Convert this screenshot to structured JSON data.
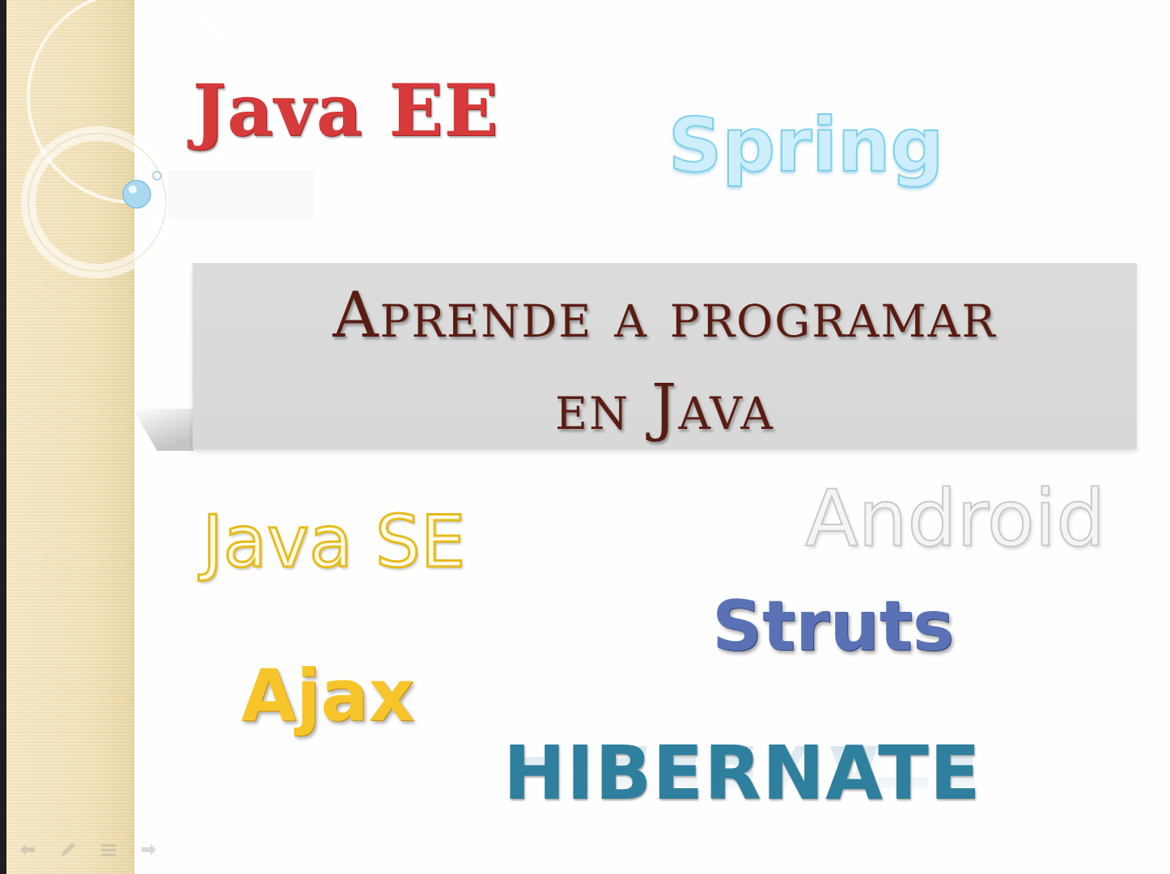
{
  "slide": {
    "title_line1": "Aprende a programar",
    "title_line2": "en Java",
    "words": {
      "java_ee": "Java EE",
      "spring": "Spring",
      "java_se": "Java SE",
      "android": "Android",
      "struts": "Struts",
      "ajax": "Ajax",
      "hibernate": "HIBERNATE"
    }
  },
  "nav": {
    "icons": [
      "back-arrow-icon",
      "pen-icon",
      "menu-icon",
      "forward-arrow-icon"
    ]
  },
  "colors": {
    "side_band": "#f2e1b6",
    "title_box": "#d9d9d9",
    "title_text": "#5a1c12",
    "java_ee": "#d63a3a",
    "spring": "#7fd0ee",
    "java_se": "#e6bb1c",
    "android": "#c9c9c9",
    "struts": "#5a72b5",
    "ajax": "#f7c52a",
    "hibernate": "#2f7f9e"
  }
}
